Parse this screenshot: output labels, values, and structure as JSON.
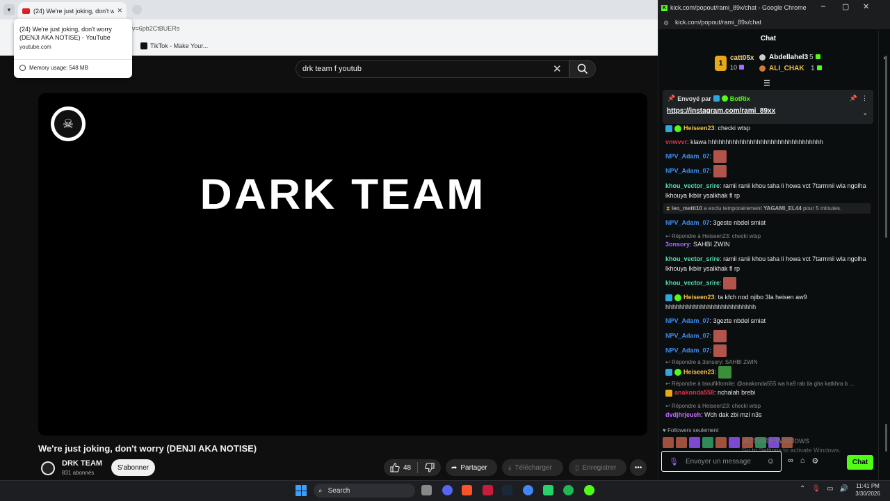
{
  "browser": {
    "tab_title": "(24) We're just joking, don't w",
    "tab_tooltip": {
      "title": "(24) We're just joking, don't worry (DENJI AKA NOTISE) - YouTube",
      "domain": "youtube.com",
      "memory": "Memory usage: 548 MB"
    },
    "url_fragment": "v=6pb2CtBUERs",
    "bookmark_tiktok": "TikTok - Make Your..."
  },
  "youtube": {
    "search_value": "drk team f youtub",
    "video_title": "We're just joking, don't worry (DENJI AKA NOTISE)",
    "player_banner": "DARK TEAM",
    "channel_name": "DRK TEAM",
    "channel_subs": "831 abonnés",
    "subscribe_label": "S'abonner",
    "like_count": "48",
    "share_label": "Partager",
    "download_label": "Télécharger",
    "save_label": "Enregistrer"
  },
  "kick": {
    "window_title": "kick.com/popout/rami_89x/chat - Google Chrome",
    "address": "kick.com/popout/rami_89x/chat",
    "header": "Chat",
    "leaderboard": {
      "first_rank": "1",
      "first_name": "catt05x",
      "first_value": "10",
      "second_name": "Abdellahel3",
      "second_value": "5",
      "third_name": "ALI_CHAK",
      "third_value": "1"
    },
    "pinned": {
      "by_label": "Envoyé par",
      "bot_name": "BotRix",
      "link": "https://instagram.com/rami_89xx"
    },
    "messages": [
      {
        "user": "Heiseen23",
        "text": "checki wtsp",
        "color": "#f3c049"
      },
      {
        "user": "vnwvvr",
        "text": "klawa hhhhhhhhhhhhhhhhhhhhhhhhhhhhhhhhh",
        "color": "#e0324a"
      },
      {
        "user": "NPV_Adam_07",
        "text": "",
        "color": "#3f8ef2"
      },
      {
        "user": "NPV_Adam_07",
        "text": "",
        "color": "#3f8ef2"
      },
      {
        "user": "khou_vector_srire",
        "text": "ramii ranii khou taha li howa vct 7tarmnii wla ngolha lkhouya lkbiir ysalkhak fl rp",
        "color": "#53e0b8"
      },
      {
        "user": "NPV_Adam_07",
        "text": "3geste nbdel smiat",
        "color": "#3f8ef2"
      },
      {
        "user": "3onsory",
        "text": "SAHBI ZWIN",
        "color": "#a66bff"
      },
      {
        "user": "khou_vector_srire",
        "text": "ramii ranii khou taha li howa vct 7tarmnii wla ngolha lkhouya lkbiir ysalkhak fl rp",
        "color": "#53e0b8"
      },
      {
        "user": "khou_vector_srire",
        "text": "",
        "color": "#53e0b8"
      },
      {
        "user": "Heiseen23",
        "text": "ta kfch nod njibo 3la heisen aw9 hhhhhhhhhhhhhhhhhhhhhhhhhh",
        "color": "#f3c049"
      },
      {
        "user": "NPV_Adam_07",
        "text": "3gezte nbdel smiat",
        "color": "#3f8ef2"
      },
      {
        "user": "NPV_Adam_07",
        "text": "",
        "color": "#3f8ef2"
      },
      {
        "user": "NPV_Adam_07",
        "text": "",
        "color": "#3f8ef2"
      },
      {
        "user": "Heiseen23",
        "text": "",
        "color": "#f3c049"
      },
      {
        "user": "anakonda558",
        "text": "nchalah brebi",
        "color": "#e0324a"
      },
      {
        "user": "dvdjhrjeueh",
        "text": "Wch dak zbi mzl n3s",
        "color": "#c86bff"
      }
    ],
    "system_message": {
      "actor": "leo_metti10",
      "action": "a exclu temporairement",
      "target": "YAGAMI_EL44",
      "duration": "pour 5 minutes."
    },
    "replies": [
      "Répondre à Heiseen23: checki wtsp",
      "Répondre à 3onsory: SAHBI ZWIN",
      "Répondre à taoufikfornile: @anakonda555 wa ha9 rab ila gha katkhra b ...",
      "Répondre à Heiseen23: checki wtsp"
    ],
    "followers_only": "Followers seulement",
    "input_placeholder": "Envoyer un message",
    "send_label": "Chat",
    "activate_line1": "Activate Windows",
    "activate_line2": "Go to Settings to activate Windows."
  },
  "taskbar": {
    "search_label": "Search",
    "time": "11:41 PM",
    "date": "3/30/2026"
  }
}
